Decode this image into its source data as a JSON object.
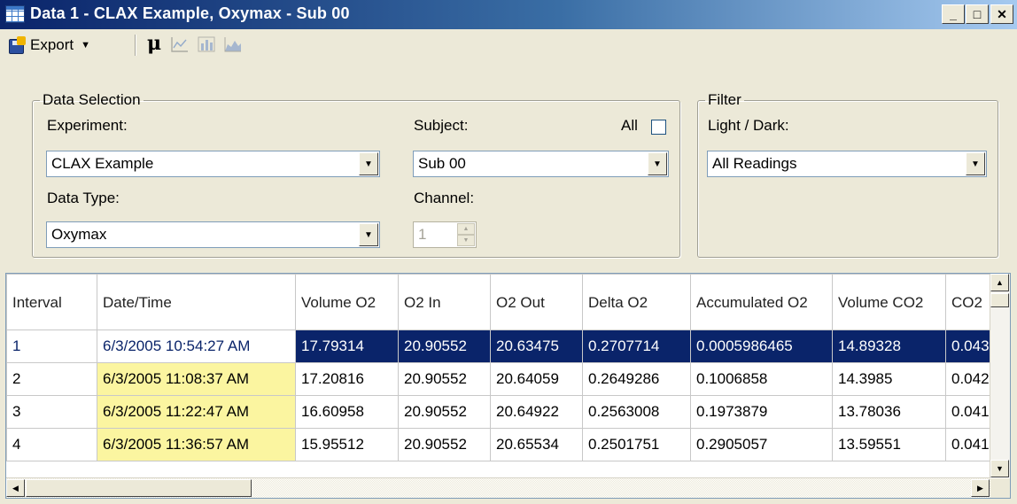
{
  "window": {
    "title": "Data 1 - CLAX Example, Oxymax - Sub 00",
    "min_glyph": "_",
    "max_glyph": "□",
    "close_glyph": "✕"
  },
  "toolbar": {
    "export_label": "Export",
    "caret": "▼",
    "mu_label": "μ",
    "icons": [
      "export-icon",
      "mu-icon",
      "line-chart-icon",
      "bar-chart-icon",
      "area-chart-icon"
    ]
  },
  "data_selection": {
    "legend": "Data Selection",
    "experiment_label": "Experiment:",
    "experiment_value": "CLAX Example",
    "data_type_label": "Data Type:",
    "data_type_value": "Oxymax",
    "subject_label": "Subject:",
    "subject_value": "Sub 00",
    "all_label": "All",
    "all_checked": false,
    "channel_label": "Channel:",
    "channel_value": "1"
  },
  "filter": {
    "legend": "Filter",
    "light_dark_label": "Light / Dark:",
    "light_dark_value": "All Readings"
  },
  "grid": {
    "columns": [
      "Interval",
      "Date/Time",
      "Volume O2",
      "O2 In",
      "O2 Out",
      "Delta O2",
      "Accumulated O2",
      "Volume CO2",
      "CO2"
    ],
    "rows": [
      [
        "1",
        "6/3/2005 10:54:27 AM",
        "17.79314",
        "20.90552",
        "20.63475",
        "0.2707714",
        "0.0005986465",
        "14.89328",
        "0.043"
      ],
      [
        "2",
        "6/3/2005 11:08:37 AM",
        "17.20816",
        "20.90552",
        "20.64059",
        "0.2649286",
        "0.1006858",
        "14.3985",
        "0.042"
      ],
      [
        "3",
        "6/3/2005 11:22:47 AM",
        "16.60958",
        "20.90552",
        "20.64922",
        "0.2563008",
        "0.1973879",
        "13.78036",
        "0.041"
      ],
      [
        "4",
        "6/3/2005 11:36:57 AM",
        "15.95512",
        "20.90552",
        "20.65534",
        "0.2501751",
        "0.2905057",
        "13.59551",
        "0.041"
      ]
    ],
    "selected_row": 0,
    "colors": {
      "selection": "#0a246a",
      "highlight": "#fbf5a0"
    }
  },
  "scroll": {
    "up": "▲",
    "down": "▼",
    "left": "◀",
    "right": "▶"
  }
}
